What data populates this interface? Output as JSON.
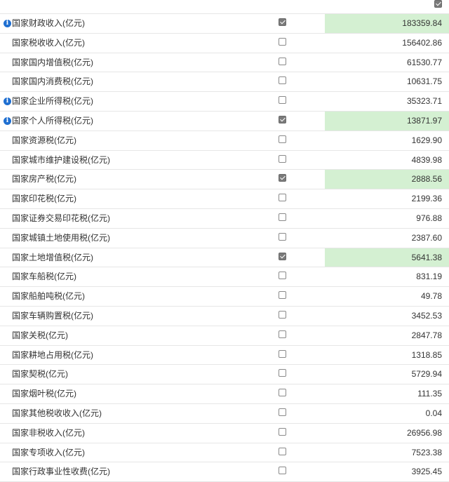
{
  "highlight_color": "#d4f0d2",
  "header": {
    "select_all_checked": true
  },
  "rows": [
    {
      "label": "国家财政收入(亿元)",
      "value": "183359.84",
      "checked": true,
      "info": true
    },
    {
      "label": "国家税收收入(亿元)",
      "value": "156402.86",
      "checked": false,
      "info": false
    },
    {
      "label": "国家国内增值税(亿元)",
      "value": "61530.77",
      "checked": false,
      "info": false
    },
    {
      "label": "国家国内消费税(亿元)",
      "value": "10631.75",
      "checked": false,
      "info": false
    },
    {
      "label": "国家企业所得税(亿元)",
      "value": "35323.71",
      "checked": false,
      "info": true
    },
    {
      "label": "国家个人所得税(亿元)",
      "value": "13871.97",
      "checked": true,
      "info": true
    },
    {
      "label": "国家资源税(亿元)",
      "value": "1629.90",
      "checked": false,
      "info": false
    },
    {
      "label": "国家城市维护建设税(亿元)",
      "value": "4839.98",
      "checked": false,
      "info": false
    },
    {
      "label": "国家房产税(亿元)",
      "value": "2888.56",
      "checked": true,
      "info": false
    },
    {
      "label": "国家印花税(亿元)",
      "value": "2199.36",
      "checked": false,
      "info": false
    },
    {
      "label": "国家证券交易印花税(亿元)",
      "value": "976.88",
      "checked": false,
      "info": false
    },
    {
      "label": "国家城镇土地使用税(亿元)",
      "value": "2387.60",
      "checked": false,
      "info": false
    },
    {
      "label": "国家土地增值税(亿元)",
      "value": "5641.38",
      "checked": true,
      "info": false
    },
    {
      "label": "国家车船税(亿元)",
      "value": "831.19",
      "checked": false,
      "info": false
    },
    {
      "label": "国家船舶吨税(亿元)",
      "value": "49.78",
      "checked": false,
      "info": false
    },
    {
      "label": "国家车辆购置税(亿元)",
      "value": "3452.53",
      "checked": false,
      "info": false
    },
    {
      "label": "国家关税(亿元)",
      "value": "2847.78",
      "checked": false,
      "info": false
    },
    {
      "label": "国家耕地占用税(亿元)",
      "value": "1318.85",
      "checked": false,
      "info": false
    },
    {
      "label": "国家契税(亿元)",
      "value": "5729.94",
      "checked": false,
      "info": false
    },
    {
      "label": "国家烟叶税(亿元)",
      "value": "111.35",
      "checked": false,
      "info": false
    },
    {
      "label": "国家其他税收收入(亿元)",
      "value": "0.04",
      "checked": false,
      "info": false
    },
    {
      "label": "国家非税收入(亿元)",
      "value": "26956.98",
      "checked": false,
      "info": false
    },
    {
      "label": "国家专项收入(亿元)",
      "value": "7523.38",
      "checked": false,
      "info": false
    },
    {
      "label": "国家行政事业性收费(亿元)",
      "value": "3925.45",
      "checked": false,
      "info": false
    }
  ]
}
